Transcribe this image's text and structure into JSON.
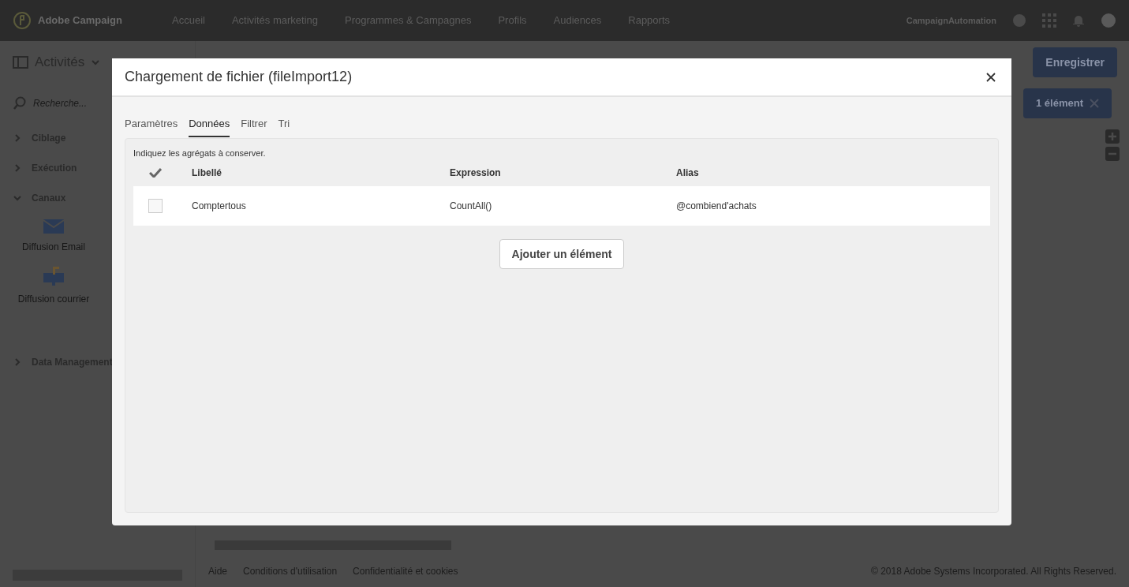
{
  "header": {
    "brand": "Adobe Campaign",
    "nav": [
      "Accueil",
      "Activités marketing",
      "Programmes & Campagnes",
      "Profils",
      "Audiences",
      "Rapports"
    ],
    "account": "CampaignAutomation"
  },
  "toolbar": {
    "title": "Activités",
    "save_button": "Enregistrer"
  },
  "sidebar": {
    "search_placeholder": "Recherche...",
    "groups": [
      {
        "label": "Ciblage",
        "expanded": false
      },
      {
        "label": "Exécution",
        "expanded": false
      },
      {
        "label": "Canaux",
        "expanded": true,
        "items": [
          {
            "label": "Diffusion Email",
            "kind": "email"
          },
          {
            "label": "Diffusion courrier",
            "kind": "mail"
          }
        ]
      },
      {
        "label": "Data Management",
        "expanded": false
      }
    ]
  },
  "canvas": {
    "selection_chip": "1 élément"
  },
  "footer": {
    "links": [
      "Aide",
      "Conditions d'utilisation",
      "Confidentialité et cookies"
    ],
    "copyright": "© 2018 Adobe Systems Incorporated. All Rights Reserved."
  },
  "dialog": {
    "title": "Chargement de fichier (fileImport12)",
    "tabs": [
      {
        "label": "Paramètres",
        "selected": false
      },
      {
        "label": "Données",
        "selected": true
      },
      {
        "label": "Filtrer",
        "selected": false
      },
      {
        "label": "Tri",
        "selected": false
      }
    ],
    "instruction": "Indiquez les agrégats à conserver.",
    "columns": [
      "Libellé",
      "Expression",
      "Alias"
    ],
    "rows": [
      {
        "checked": false,
        "cells": [
          "Comptertous",
          "CountAll()",
          "@combiend'achats"
        ]
      }
    ],
    "add_button": "Ajouter un élément"
  }
}
